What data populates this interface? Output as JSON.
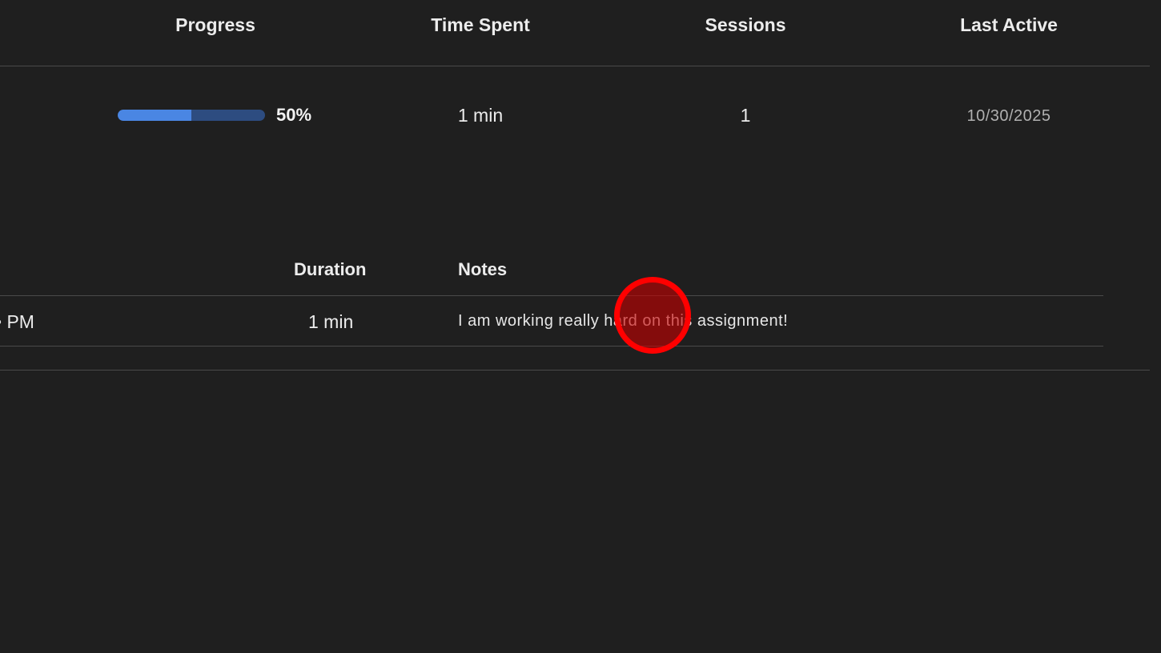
{
  "table": {
    "headers": {
      "progress": "Progress",
      "time_spent": "Time Spent",
      "sessions": "Sessions",
      "last_active": "Last Active"
    },
    "row": {
      "progress_fraction": 0.5,
      "progress_label": "50%",
      "time_spent": "1 min",
      "sessions": "1",
      "last_active": "10/30/2025"
    }
  },
  "sessions_table": {
    "headers": {
      "duration": "Duration",
      "notes": "Notes"
    },
    "row": {
      "time_fragment": "PM",
      "duration": "1 min",
      "notes": "I am working really hard on this assignment!"
    }
  },
  "colors": {
    "background": "#1f1f1f",
    "progress_fill": "#4a86e3",
    "progress_track": "#2d4c80",
    "click_indicator": "#ff0000"
  }
}
